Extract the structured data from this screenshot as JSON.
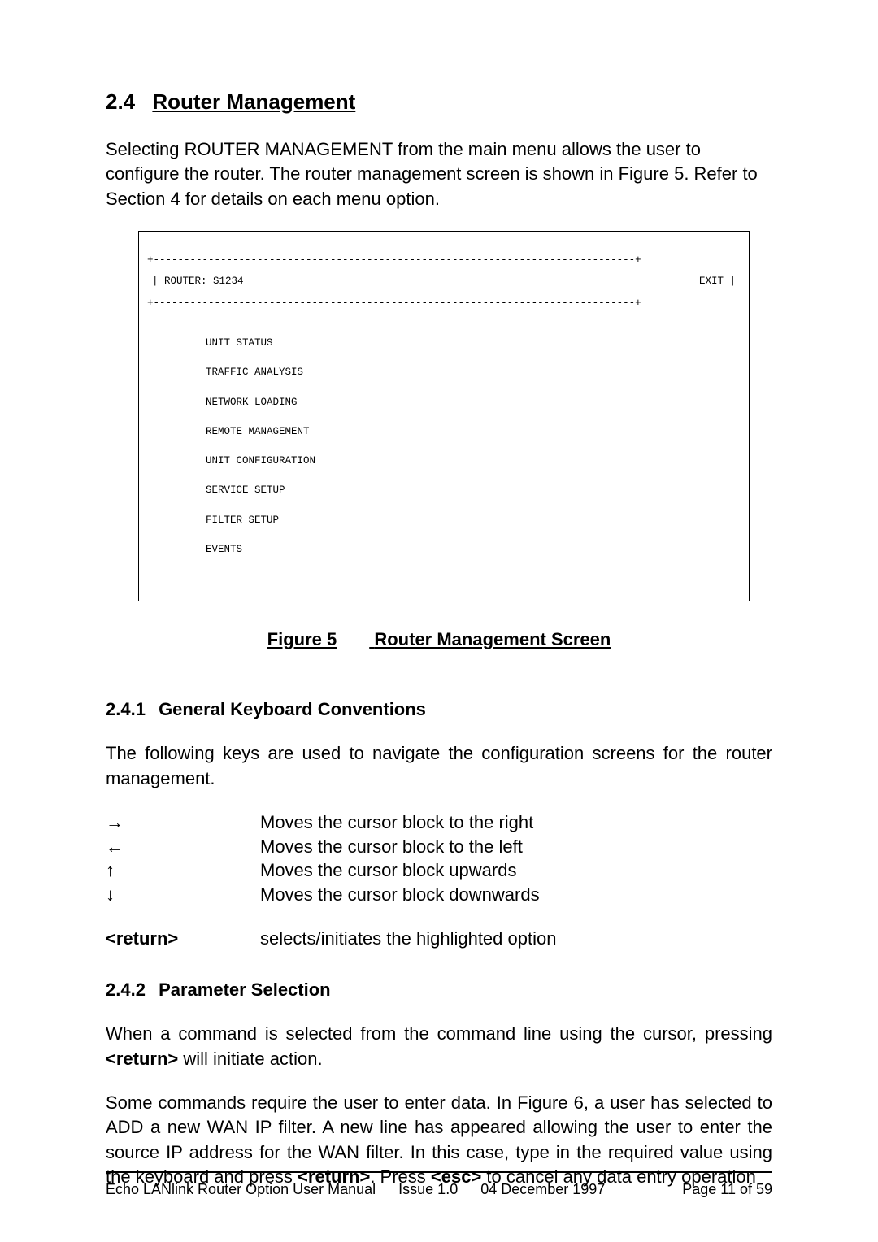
{
  "section": {
    "number": "2.4",
    "title": "Router Management",
    "intro": "Selecting ROUTER MANAGEMENT from the main menu allows the user to configure the router. The router management screen is shown in Figure 5. Refer to Section 4 for details on each menu option."
  },
  "terminal": {
    "border_top": "+-------------------------------------------------------------------------------+",
    "header_left": "| ROUTER: S1234",
    "header_right": "EXIT |",
    "border_mid": "+-------------------------------------------------------------------------------+",
    "items": [
      "UNIT STATUS",
      "TRAFFIC ANALYSIS",
      "NETWORK LOADING",
      "REMOTE MANAGEMENT",
      "UNIT CONFIGURATION",
      "SERVICE SETUP",
      "FILTER SETUP",
      "EVENTS"
    ]
  },
  "figure": {
    "label": "Figure 5",
    "title": "Router Management Screen"
  },
  "sub1": {
    "number": "2.4.1",
    "title": "General Keyboard Conventions",
    "intro": "The following keys are used to navigate the configuration screens for the router management.",
    "keys": [
      {
        "k": "→",
        "d": "Moves the cursor block to the right"
      },
      {
        "k": "←",
        "d": "Moves the cursor block to the left"
      },
      {
        "k": "↑",
        "d": "Moves the cursor block upwards"
      },
      {
        "k": "↓",
        "d": "Moves the cursor block downwards"
      }
    ],
    "return_key": "<return>",
    "return_desc": "selects/initiates the highlighted option"
  },
  "sub2": {
    "number": "2.4.2",
    "title": "Parameter Selection",
    "p1_a": "When a command is selected from the command line using the cursor, pressing ",
    "p1_b": "<return>",
    "p1_c": " will initiate action.",
    "p2_a": "Some commands require the user to enter data. In Figure 6, a user has selected to ADD a new WAN IP filter. A new line has appeared allowing the user to enter the source IP address for the WAN filter. In this case, type in the required value using the keyboard and press ",
    "p2_b": "<return>",
    "p2_c": ". Press ",
    "p2_d": "<esc>",
    "p2_e": " to cancel any data entry operation"
  },
  "footer": {
    "title": "Echo LANlink Router Option User Manual",
    "issue": "Issue 1.0",
    "date": "04 December 1997",
    "page": "Page 11 of 59"
  }
}
